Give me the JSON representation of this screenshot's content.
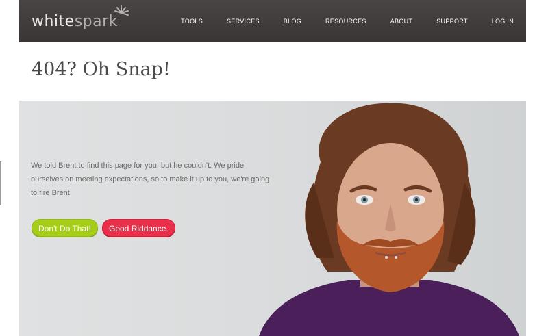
{
  "header": {
    "logo": {
      "part1": "white",
      "part2": "spark"
    },
    "nav": [
      {
        "label": "TOOLS"
      },
      {
        "label": "SERVICES"
      },
      {
        "label": "BLOG"
      },
      {
        "label": "RESOURCES"
      },
      {
        "label": "ABOUT"
      },
      {
        "label": "SUPPORT"
      },
      {
        "label": "LOG IN"
      }
    ]
  },
  "main": {
    "title": "404? Oh Snap!",
    "message": "We told Brent to find this page for you, but he couldn't. We pride ourselves on meeting expectations, so to make it up to you, we're going to fire Brent.",
    "buttons": {
      "keep": "Don't Do That!",
      "fire": "Good Riddance."
    }
  },
  "colors": {
    "header_bg": "#403b3b",
    "green": "#a6ce19",
    "red": "#e9304a",
    "hero_bg": "#dcdfe0"
  }
}
